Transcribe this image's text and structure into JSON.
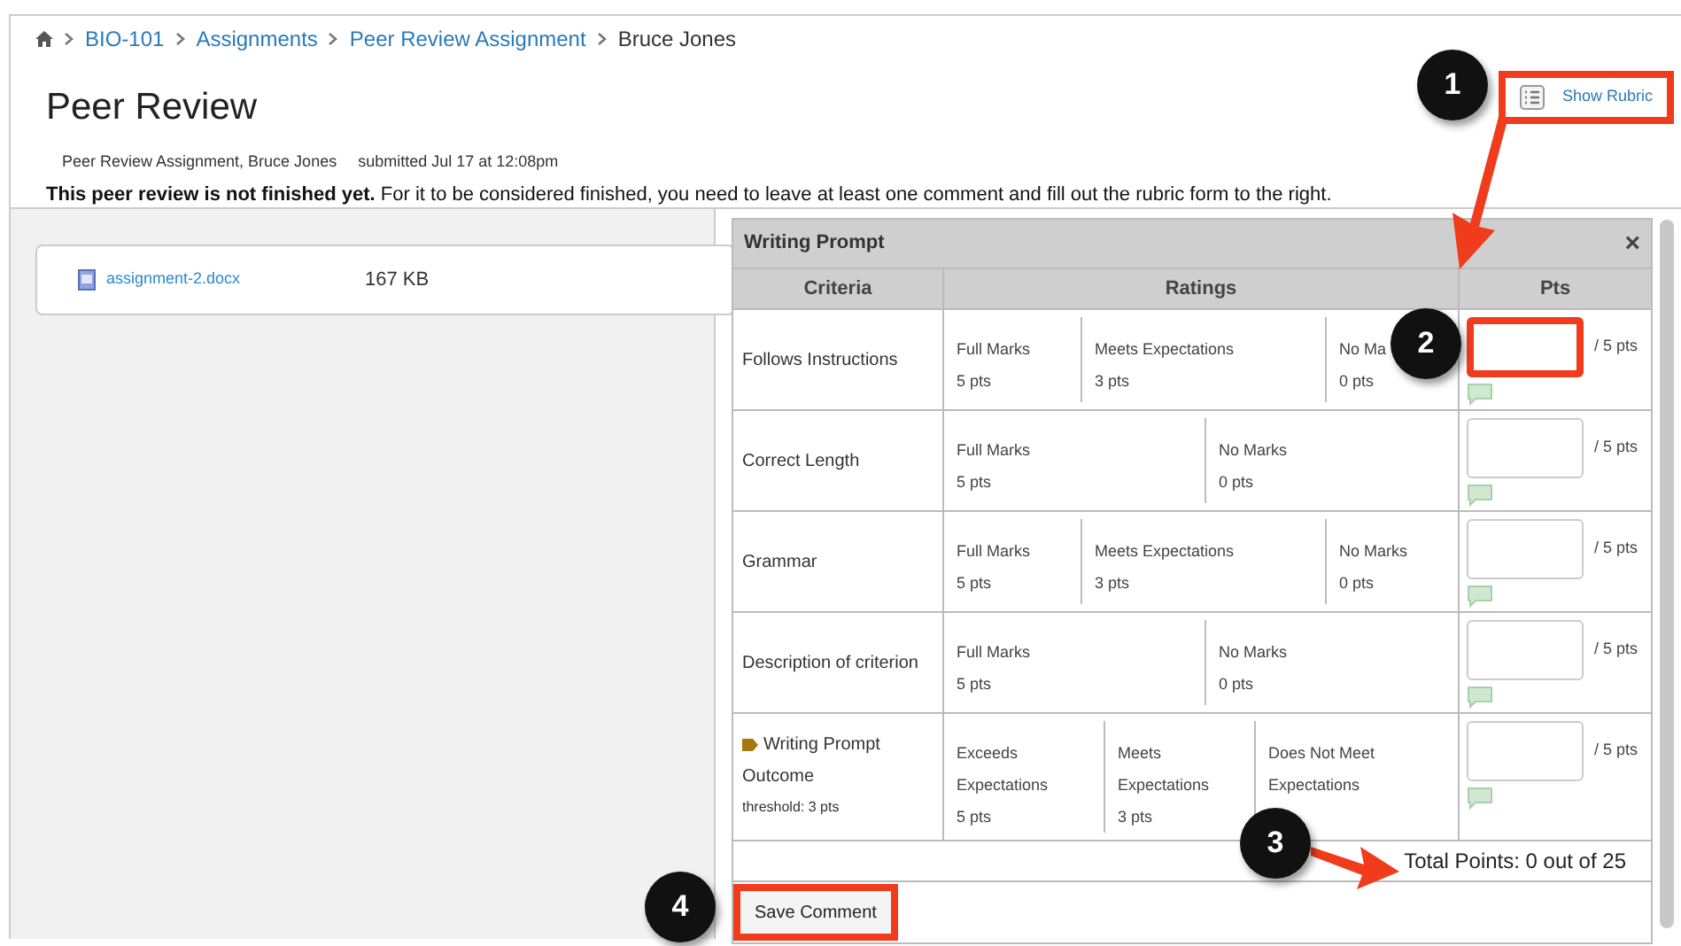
{
  "breadcrumb": [
    {
      "kind": "home"
    },
    {
      "kind": "link",
      "label": "BIO-101"
    },
    {
      "kind": "link",
      "label": "Assignments"
    },
    {
      "kind": "link",
      "label": "Peer Review Assignment"
    },
    {
      "kind": "current",
      "label": "Bruce Jones"
    }
  ],
  "header": {
    "title": "Peer Review",
    "assignment": "Peer Review Assignment, Bruce Jones",
    "submitted": "submitted Jul 17 at 12:08pm",
    "notice": "**This peer review is not finished yet.** For it to be considered finished, you need to leave at least one comment and fill out the rubric form to the right."
  },
  "show_rubric": {
    "label": "Show Rubric",
    "highlighted": true
  },
  "attachment": {
    "filename": "assignment-2.docx",
    "size": "167 KB"
  },
  "rubric": {
    "title": "Writing Prompt",
    "close": "×",
    "columns": [
      "Criteria",
      "Ratings",
      "Pts"
    ],
    "criteria": [
      {
        "kind": "plain",
        "name": "Follows Instructions",
        "ratings": [
          {
            "label": "Full Marks",
            "points": "5 pts"
          },
          {
            "label": "Meets Expectations",
            "points": "3 pts"
          },
          {
            "label": "No Ma",
            "points": "0 pts"
          }
        ],
        "points_suffix": "/ 5 pts",
        "highlighted": true
      },
      {
        "kind": "plain",
        "name": "Correct Length",
        "ratings": [
          {
            "label": "Full Marks",
            "points": "5 pts"
          },
          {
            "label": "No Marks",
            "points": "0 pts"
          }
        ],
        "points_suffix": "/ 5 pts",
        "highlighted": false
      },
      {
        "kind": "plain",
        "name": "Grammar",
        "ratings": [
          {
            "label": "Full Marks",
            "points": "5 pts"
          },
          {
            "label": "Meets Expectations",
            "points": "3 pts"
          },
          {
            "label": "No Marks",
            "points": "0 pts"
          }
        ],
        "points_suffix": "/ 5 pts",
        "highlighted": false
      },
      {
        "kind": "plain",
        "name": "Description of criterion",
        "ratings": [
          {
            "label": "Full Marks",
            "points": "5 pts"
          },
          {
            "label": "No Marks",
            "points": "0 pts"
          }
        ],
        "points_suffix": "/ 5 pts",
        "highlighted": false
      },
      {
        "kind": "outcome",
        "name": "Writing Prompt Outcome",
        "threshold": "threshold: 3 pts",
        "ratings": [
          {
            "label": "Exceeds Expectations",
            "points": "5 pts"
          },
          {
            "label": "Meets Expectations",
            "points": "3 pts"
          },
          {
            "label": "Does Not Meet Expectations"
          }
        ],
        "points_suffix": "/ 5 pts",
        "highlighted": false
      }
    ],
    "total": "Total Points: 0 out of 25"
  },
  "save_button": {
    "label": "Save Comment",
    "highlighted": true
  },
  "callouts": [
    "1",
    "2",
    "3",
    "4"
  ]
}
